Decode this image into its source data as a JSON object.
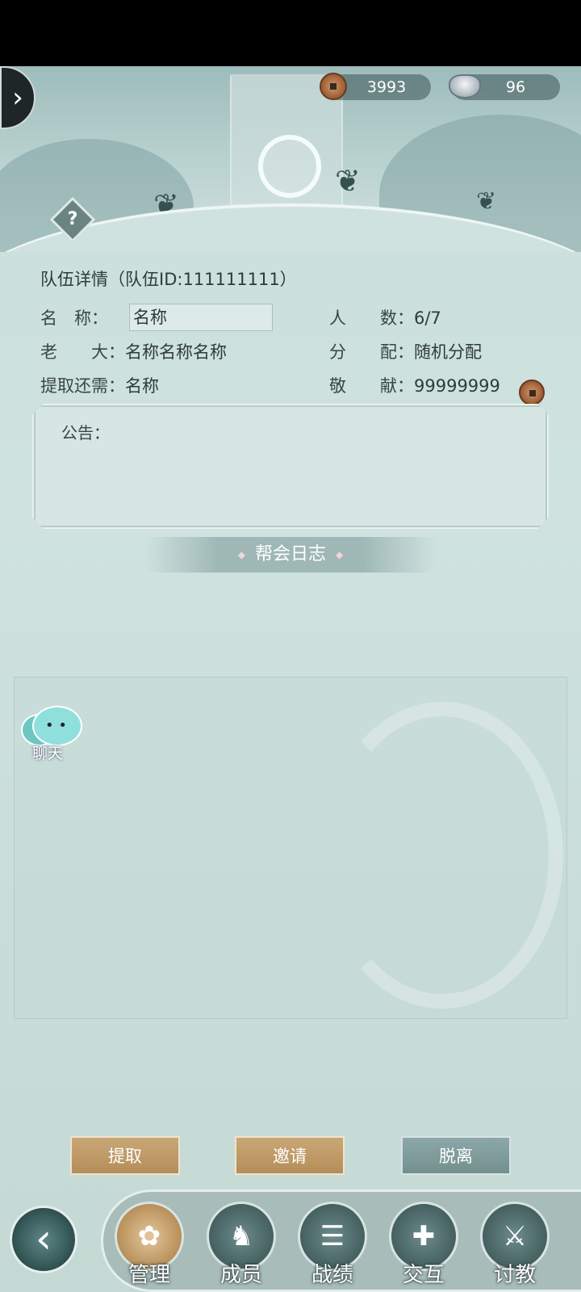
{
  "currencies": {
    "copper": {
      "value": "3993",
      "icon": "copper-coin-icon"
    },
    "silver": {
      "value": "96",
      "icon": "silver-ingot-icon"
    }
  },
  "team": {
    "title": "队伍详情（队伍ID:111111111）",
    "name_label": "名　称：",
    "name_value": "名称",
    "members_label": "人　　数：",
    "members_value": "6/7",
    "leader_label": "老　　大：",
    "leader_value": "名称名称名称",
    "distribution_label": "分　　配：",
    "distribution_value": "随机分配",
    "withdraw_label": "提取还需：",
    "withdraw_value": "名称",
    "contribution_label": "敬　　献：",
    "contribution_value": "99999999"
  },
  "notice": {
    "label": "公告："
  },
  "log": {
    "title": "帮会日志"
  },
  "chat": {
    "label": "聊天"
  },
  "actions": {
    "withdraw": "提取",
    "invite": "邀请",
    "leave": "脱离"
  },
  "nav": {
    "items": [
      {
        "label": "管理",
        "icon": "manage-icon",
        "active": true
      },
      {
        "label": "成员",
        "icon": "members-icon",
        "active": false
      },
      {
        "label": "战绩",
        "icon": "record-icon",
        "active": false
      },
      {
        "label": "交互",
        "icon": "interact-icon",
        "active": false
      },
      {
        "label": "讨教",
        "icon": "challenge-icon",
        "active": false
      }
    ]
  },
  "colors": {
    "background": "#cfe2df",
    "gold_button": "#c9a776",
    "grey_button": "#8ca7a7",
    "nav_active": "#e3c79b"
  }
}
